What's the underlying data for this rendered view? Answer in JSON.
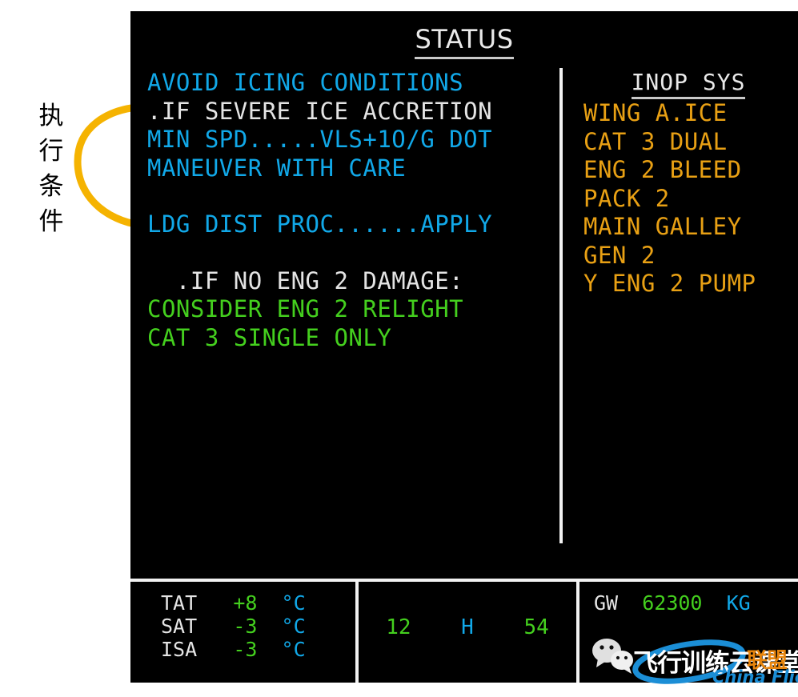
{
  "annotation": {
    "label_chars": [
      "执",
      "行",
      "条",
      "件"
    ],
    "arrow_color": "#f5b301"
  },
  "display": {
    "background": "#000000",
    "title": "STATUS",
    "colors": {
      "cyan": "#11a8e8",
      "white": "#e4e4e4",
      "green": "#44cf1e",
      "amber": "#e8a014"
    },
    "procedure_lines": [
      {
        "text": "AVOID ICING CONDITIONS",
        "color": "cyan",
        "gap_before": false
      },
      {
        "text": ".IF SEVERE ICE ACCRETION",
        "color": "white",
        "gap_before": false
      },
      {
        "text": "MIN SPD.....VLS+1O/G DOT",
        "color": "cyan",
        "gap_before": false
      },
      {
        "text": "MANEUVER WITH CARE",
        "color": "cyan",
        "gap_before": false
      },
      {
        "text": "LDG DIST PROC......APPLY",
        "color": "cyan",
        "gap_before": true
      },
      {
        "text": "  .IF NO ENG 2 DAMAGE:",
        "color": "white",
        "gap_before": true
      },
      {
        "text": "CONSIDER ENG 2 RELIGHT",
        "color": "green",
        "gap_before": false
      },
      {
        "text": "CAT 3 SINGLE ONLY",
        "color": "green",
        "gap_before": false
      }
    ],
    "inop": {
      "title": "INOP SYS",
      "items": [
        "WING A.ICE",
        "CAT 3 DUAL",
        "ENG 2 BLEED",
        "PACK 2",
        "MAIN GALLEY",
        "GEN 2",
        "Y ENG 2 PUMP"
      ]
    }
  },
  "bottom": {
    "temperatures": [
      {
        "label": "TAT",
        "value": "+8",
        "unit": "°C"
      },
      {
        "label": "SAT",
        "value": "-3",
        "unit": "°C"
      },
      {
        "label": "ISA",
        "value": "-3",
        "unit": "°C"
      }
    ],
    "clock": {
      "hours": "12",
      "separator": "H",
      "minutes": "54"
    },
    "gross_weight": {
      "label": "GW",
      "value": "62300",
      "unit": "KG"
    }
  },
  "watermark": {
    "cn_text": "飞行训练云课堂",
    "union_text": "联盟",
    "latin_text": "China Flier",
    "wechat_icon": "wechat-icon"
  }
}
